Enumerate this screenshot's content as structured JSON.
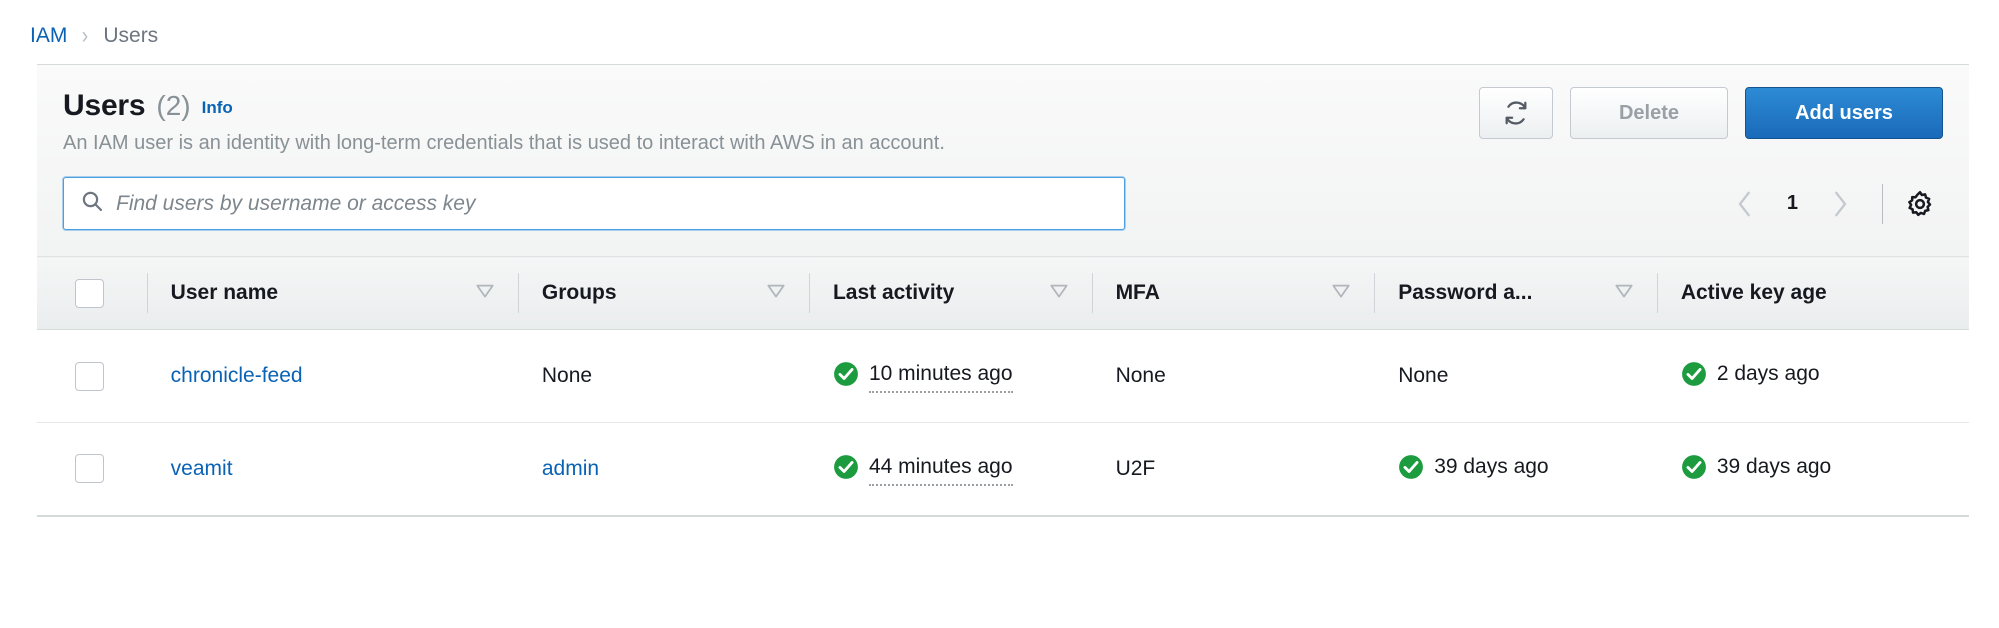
{
  "breadcrumb": {
    "root": "IAM",
    "separator": "›",
    "current": "Users"
  },
  "panel": {
    "title": "Users",
    "count": "(2)",
    "info_label": "Info",
    "description": "An IAM user is an identity with long-term credentials that is used to interact with AWS in an account."
  },
  "actions": {
    "refresh_icon": "refresh-icon",
    "delete_label": "Delete",
    "add_users_label": "Add users"
  },
  "search": {
    "icon": "search-icon",
    "placeholder": "Find users by username or access key",
    "value": ""
  },
  "pagination": {
    "prev_icon": "chevron-left-icon",
    "page": "1",
    "next_icon": "chevron-right-icon",
    "settings_icon": "gear-icon"
  },
  "table": {
    "columns": [
      {
        "label": "User name",
        "sortable": true
      },
      {
        "label": "Groups",
        "sortable": true
      },
      {
        "label": "Last activity",
        "sortable": true
      },
      {
        "label": "MFA",
        "sortable": true
      },
      {
        "label": "Password a...",
        "sortable": true
      },
      {
        "label": "Active key age",
        "sortable": false
      }
    ],
    "rows": [
      {
        "selected": false,
        "user_name": "chronicle-feed",
        "groups": "None",
        "groups_is_link": false,
        "last_activity": "10 minutes ago",
        "last_activity_status": true,
        "mfa": "None",
        "mfa_status": false,
        "password_age": "None",
        "password_age_status": false,
        "active_key_age": "2 days ago",
        "active_key_age_status": true
      },
      {
        "selected": false,
        "user_name": "veamit",
        "groups": "admin",
        "groups_is_link": true,
        "last_activity": "44 minutes ago",
        "last_activity_status": true,
        "mfa": "U2F",
        "mfa_status": false,
        "password_age": "39 days ago",
        "password_age_status": true,
        "active_key_age": "39 days ago",
        "active_key_age_status": true
      }
    ]
  },
  "colors": {
    "link_blue": "#0a62b5",
    "primary_button": "#1a6aba",
    "status_green": "#1d9c3f",
    "muted_text": "#879196",
    "heading_text": "#16191f"
  }
}
